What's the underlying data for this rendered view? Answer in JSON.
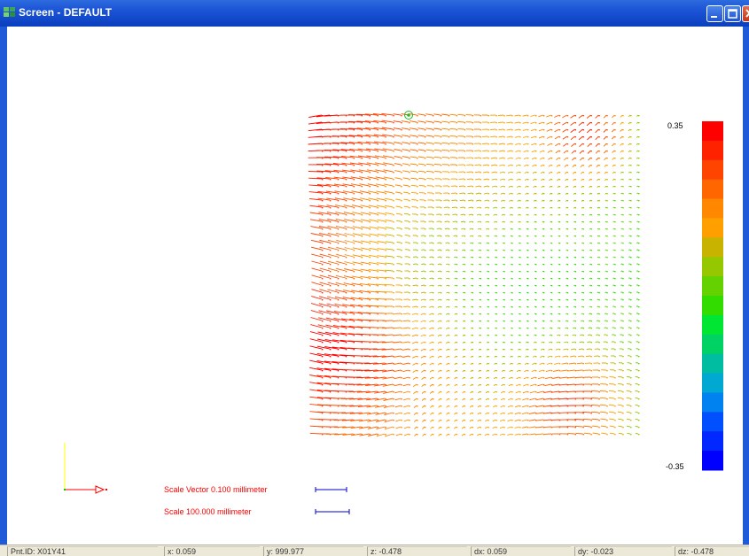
{
  "window": {
    "title": "Screen - DEFAULT",
    "title_icon": "app-grid-icon",
    "buttons": [
      "minimize-icon",
      "maximize-icon",
      "close-icon"
    ]
  },
  "color_legend": {
    "max_label": "0.35",
    "min_label": "-0.35",
    "colors_top_to_bottom": [
      "#ff0000",
      "#ff2200",
      "#ff4400",
      "#ff6600",
      "#ff8800",
      "#ffa000",
      "#c8b400",
      "#96c800",
      "#64d200",
      "#32dc00",
      "#00e632",
      "#00d264",
      "#00bca0",
      "#00a8d2",
      "#0082f0",
      "#0050ff",
      "#0028ff",
      "#0000ff"
    ]
  },
  "axis_triad": {
    "x_color": "#ff0000",
    "y_color": "#ffff00",
    "origin_color": "#00cc00"
  },
  "scales": {
    "vector_label": "Scale Vector 0.100 millimeter",
    "length_label": "Scale 100.000 millimeter",
    "bar_color": "#0000cc"
  },
  "statusbar": {
    "pnt_id": "Pnt.ID: X01Y41",
    "x": "x: 0.059",
    "y": "y: 999.977",
    "z": "z: -0.478",
    "dx": "dx: 0.059",
    "dy": "dy: -0.023",
    "dz": "dz: -0.478"
  }
}
